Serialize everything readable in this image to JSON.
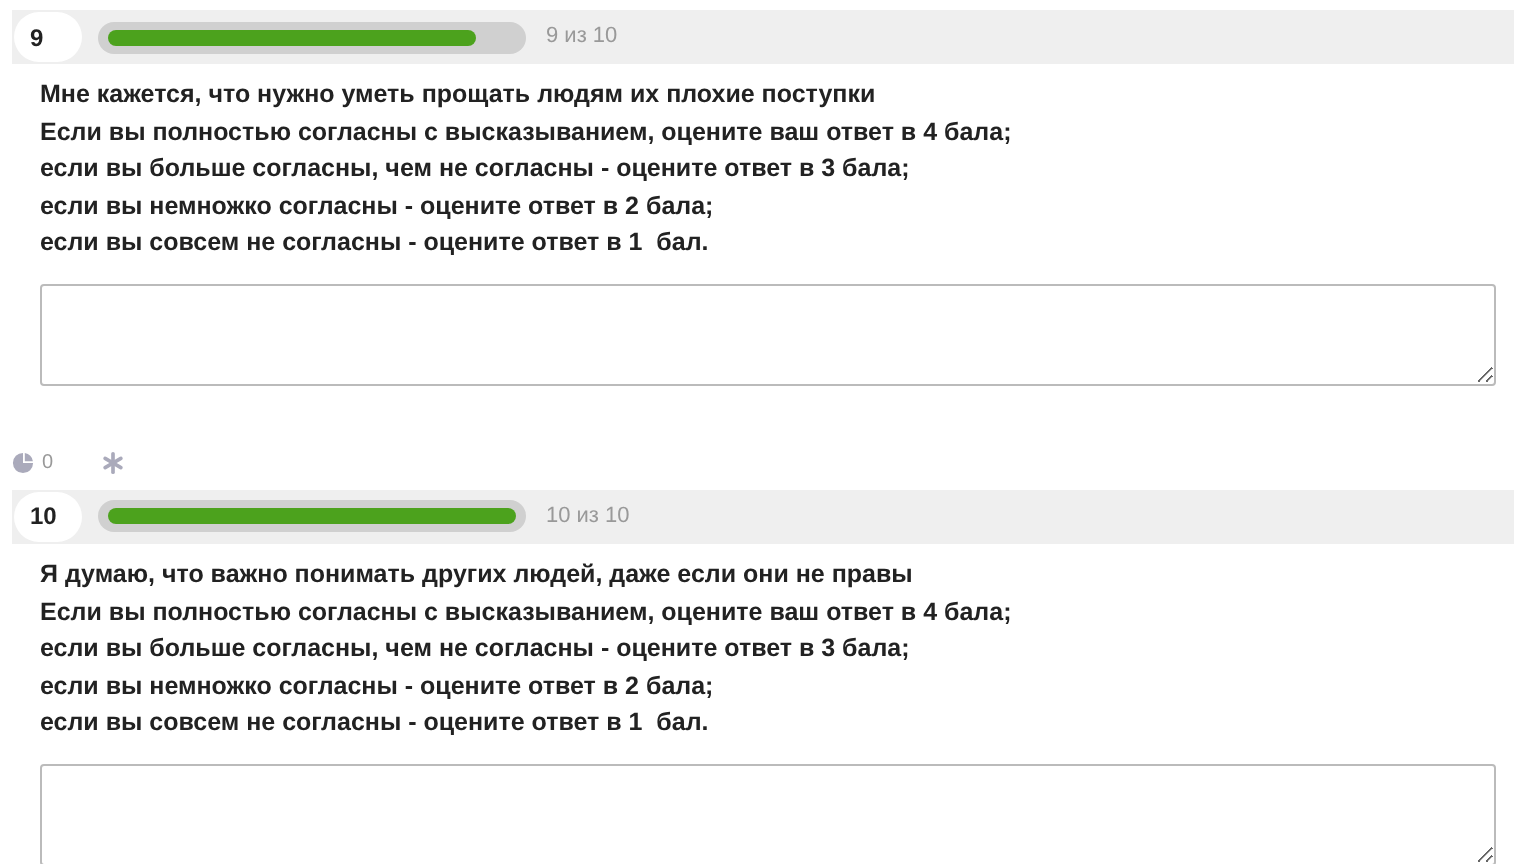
{
  "questions": [
    {
      "number": "9",
      "progress": {
        "level": 0.9,
        "label": "9 из 10"
      },
      "lines": [
        "Мне кажется, что нужно уметь прощать людям их плохие поступки",
        "Если вы полностью согласны с высказыванием, оцените ваш ответ в 4 бала;",
        "если вы больше согласны, чем не согласны - оцените ответ в 3 бала;",
        "если вы немножко согласны - оцените ответ в 2 бала;",
        "если вы совсем не согласны - оцените ответ в 1  бал."
      ],
      "toolbar": {
        "count": "0"
      }
    },
    {
      "number": "10",
      "progress": {
        "level": 1.0,
        "label": "10 из 10"
      },
      "lines": [
        "Я думаю, что важно понимать других людей, даже если они не правы",
        "Если вы полностью согласны с высказыванием, оцените ваш ответ в 4 бала;",
        "если вы больше согласны, чем не согласны - оцените ответ в 3 бала;",
        "если вы немножко согласны - оцените ответ в 2 бала;",
        "если вы совсем не согласны - оцените ответ в 1  бал."
      ]
    }
  ]
}
